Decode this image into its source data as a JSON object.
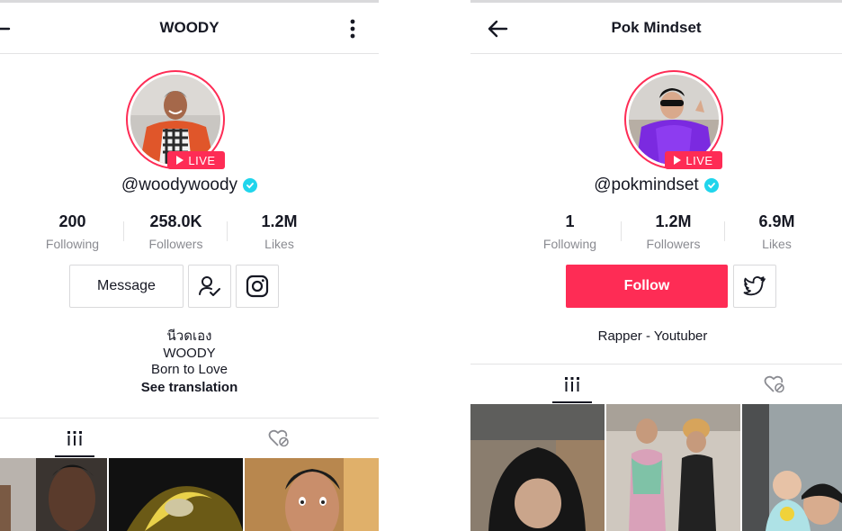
{
  "left_profile": {
    "title": "WOODY",
    "back_icon": "back-arrow-icon",
    "menu_icon": "more-vertical-icon",
    "live_label": "LIVE",
    "handle": "@woodywoody",
    "verified_icon": "verified-check-icon",
    "stats": [
      {
        "value": "200",
        "label": "Following"
      },
      {
        "value": "258.0K",
        "label": "Followers"
      },
      {
        "value": "1.2M",
        "label": "Likes"
      }
    ],
    "message_label": "Message",
    "friend_icon": "user-check-icon",
    "social_icon": "instagram-icon",
    "bio_lines": [
      "นีวดเอง",
      "WOODY",
      "Born to Love"
    ],
    "see_translation": "See translation",
    "tab_videos_icon": "videos-grid-icon",
    "tab_liked_icon": "liked-hidden-icon"
  },
  "right_profile": {
    "title": "Pok Mindset",
    "back_icon": "back-arrow-icon",
    "live_label": "LIVE",
    "handle": "@pokmindset",
    "verified_icon": "verified-check-icon",
    "stats": [
      {
        "value": "1",
        "label": "Following"
      },
      {
        "value": "1.2M",
        "label": "Followers"
      },
      {
        "value": "6.9M",
        "label": "Likes"
      }
    ],
    "follow_label": "Follow",
    "social_icon": "twitter-icon",
    "bio": "Rapper - Youtuber",
    "tab_videos_icon": "videos-grid-icon",
    "tab_liked_icon": "liked-hidden-icon"
  },
  "colors": {
    "accent": "#fe2c55",
    "verified": "#20d5ec",
    "text": "#161823",
    "muted": "#8a8b91",
    "divider": "#e3e3e4"
  }
}
